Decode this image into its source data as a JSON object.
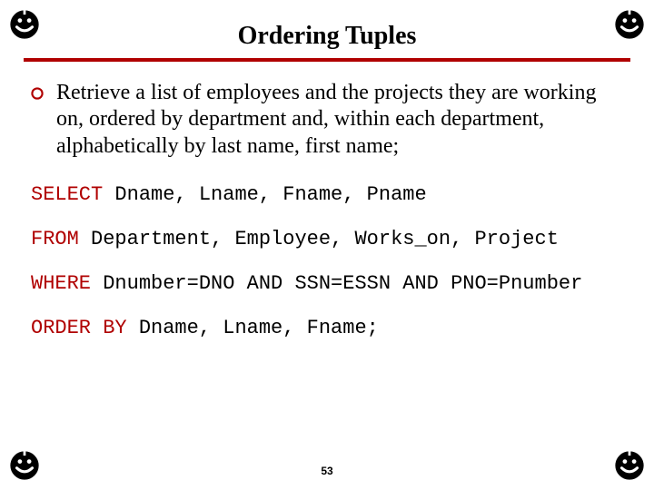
{
  "title": "Ordering Tuples",
  "bullet_text": "Retrieve a list of employees and the projects they are working on, ordered by department and, within each department, alphabetically by last name, first name;",
  "sql": {
    "line1_kw": "SELECT",
    "line1_rest": " Dname, Lname, Fname, Pname",
    "line2_kw": "FROM",
    "line2_rest": " Department, Employee, Works_on, Project",
    "line3_kw": "WHERE",
    "line3_rest": " Dnumber=DNO AND SSN=ESSN AND PNO=Pnumber",
    "line4_kw": "ORDER BY",
    "line4_rest": " Dname, Lname, Fname;"
  },
  "page_number": "53"
}
